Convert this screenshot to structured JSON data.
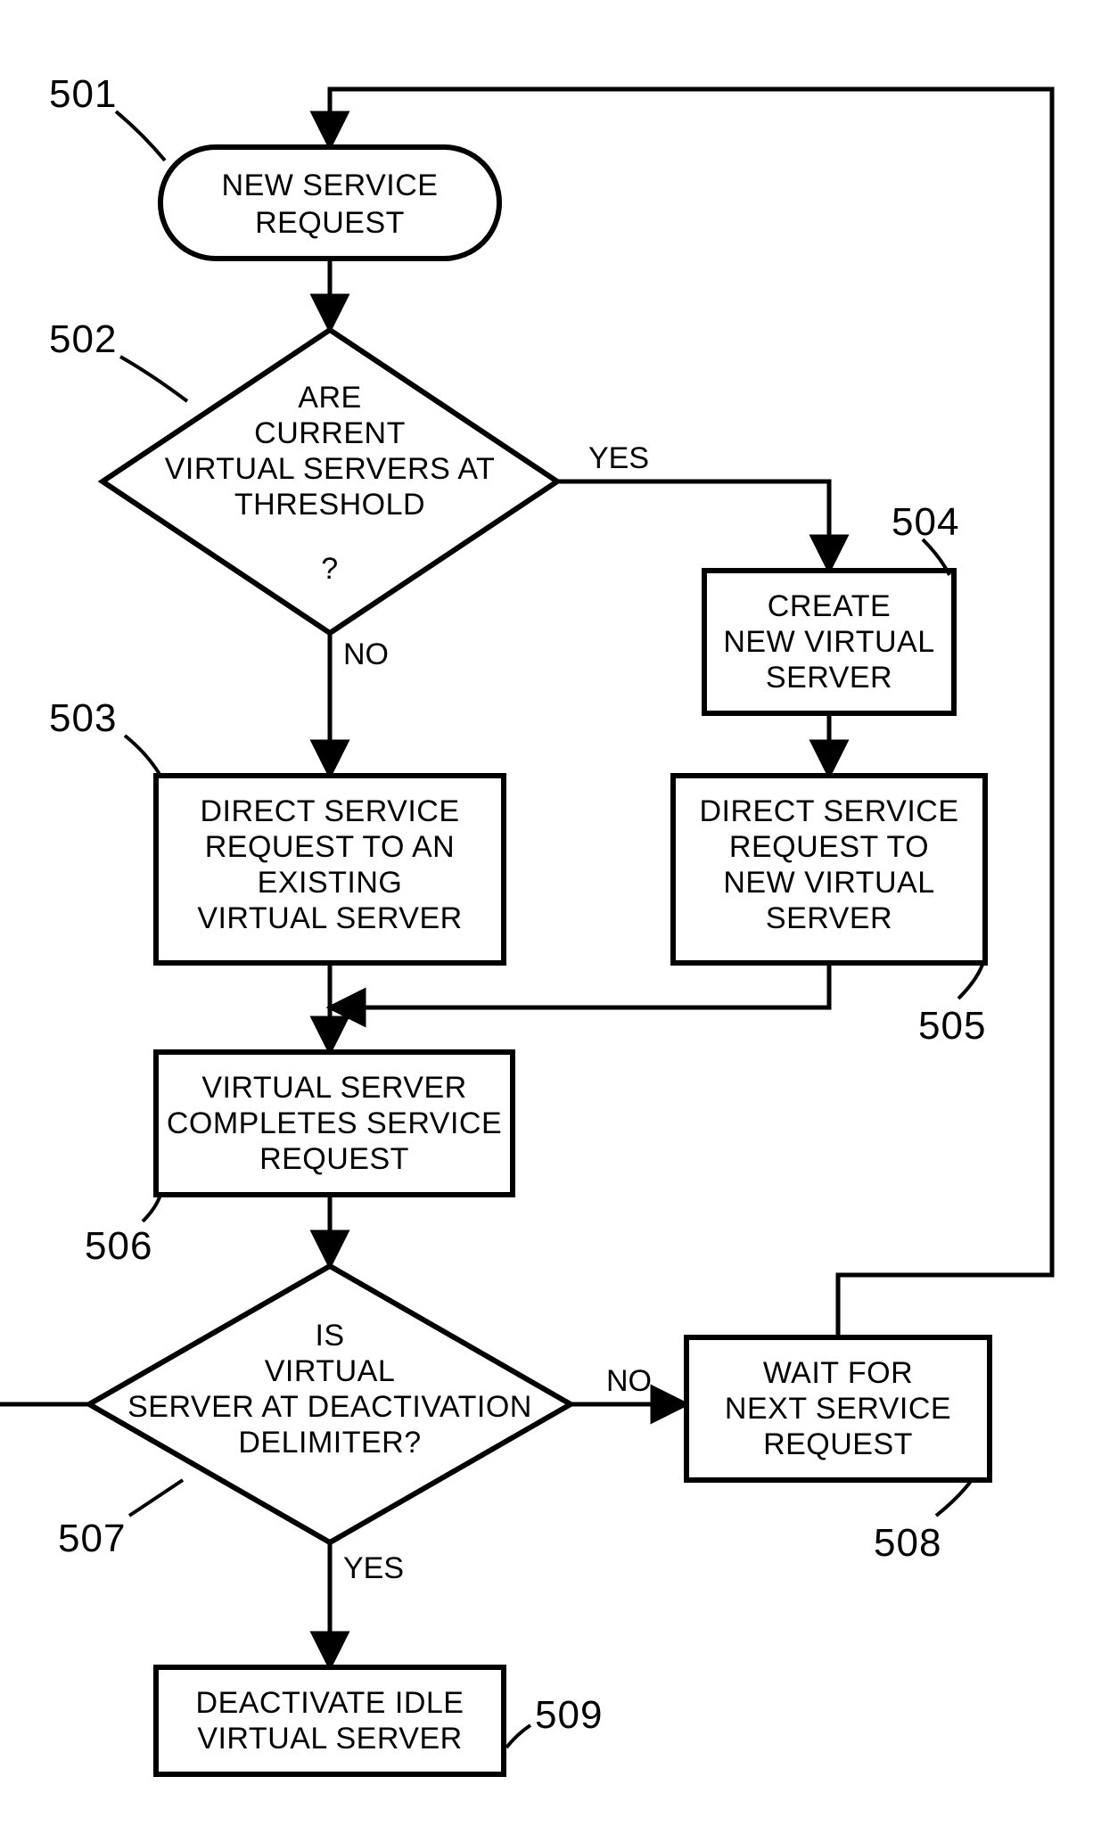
{
  "chart_data": {
    "type": "flowchart",
    "title": "",
    "nodes": [
      {
        "id": "501",
        "shape": "terminator",
        "label": "NEW SERVICE REQUEST"
      },
      {
        "id": "502",
        "shape": "decision",
        "label": "ARE CURRENT VIRTUAL SERVERS AT THRESHOLD ?"
      },
      {
        "id": "503",
        "shape": "process",
        "label": "DIRECT SERVICE REQUEST TO AN EXISTING VIRTUAL SERVER"
      },
      {
        "id": "504",
        "shape": "process",
        "label": "CREATE NEW VIRTUAL SERVER"
      },
      {
        "id": "505",
        "shape": "process",
        "label": "DIRECT SERVICE REQUEST TO NEW VIRTUAL SERVER"
      },
      {
        "id": "506",
        "shape": "process",
        "label": "VIRTUAL SERVER COMPLETES SERVICE REQUEST"
      },
      {
        "id": "507",
        "shape": "decision",
        "label": "IS VIRTUAL SERVER AT DEACTIVATION DELIMITER?"
      },
      {
        "id": "508",
        "shape": "process",
        "label": "WAIT FOR NEXT SERVICE REQUEST"
      },
      {
        "id": "509",
        "shape": "process",
        "label": "DEACTIVATE IDLE VIRTUAL SERVER"
      }
    ],
    "edges": [
      {
        "from": "501",
        "to": "502",
        "label": ""
      },
      {
        "from": "502",
        "to": "504",
        "label": "YES"
      },
      {
        "from": "502",
        "to": "503",
        "label": "NO"
      },
      {
        "from": "504",
        "to": "505",
        "label": ""
      },
      {
        "from": "503",
        "to": "506",
        "label": ""
      },
      {
        "from": "505",
        "to": "506",
        "label": ""
      },
      {
        "from": "506",
        "to": "507",
        "label": ""
      },
      {
        "from": "507",
        "to": "508",
        "label": "NO"
      },
      {
        "from": "507",
        "to": "509",
        "label": "YES"
      },
      {
        "from": "508",
        "to": "501",
        "label": ""
      }
    ]
  },
  "labels": {
    "n501_l1": "NEW SERVICE",
    "n501_l2": "REQUEST",
    "n502_l1": "ARE",
    "n502_l2": "CURRENT",
    "n502_l3": "VIRTUAL SERVERS AT",
    "n502_l4": "THRESHOLD",
    "n502_l5": "?",
    "n503_l1": "DIRECT SERVICE",
    "n503_l2": "REQUEST TO AN",
    "n503_l3": "EXISTING",
    "n503_l4": "VIRTUAL SERVER",
    "n504_l1": "CREATE",
    "n504_l2": "NEW VIRTUAL",
    "n504_l3": "SERVER",
    "n505_l1": "DIRECT SERVICE",
    "n505_l2": "REQUEST TO",
    "n505_l3": "NEW VIRTUAL",
    "n505_l4": "SERVER",
    "n506_l1": "VIRTUAL SERVER",
    "n506_l2": "COMPLETES SERVICE",
    "n506_l3": "REQUEST",
    "n507_l1": "IS",
    "n507_l2": "VIRTUAL",
    "n507_l3": "SERVER AT DEACTIVATION",
    "n507_l4": "DELIMITER?",
    "n508_l1": "WAIT FOR",
    "n508_l2": "NEXT SERVICE",
    "n508_l3": "REQUEST",
    "n509_l1": "DEACTIVATE IDLE",
    "n509_l2": "VIRTUAL SERVER",
    "ref501": "501",
    "ref502": "502",
    "ref503": "503",
    "ref504": "504",
    "ref505": "505",
    "ref506": "506",
    "ref507": "507",
    "ref508": "508",
    "ref509": "509",
    "yes": "YES",
    "no": "NO"
  }
}
